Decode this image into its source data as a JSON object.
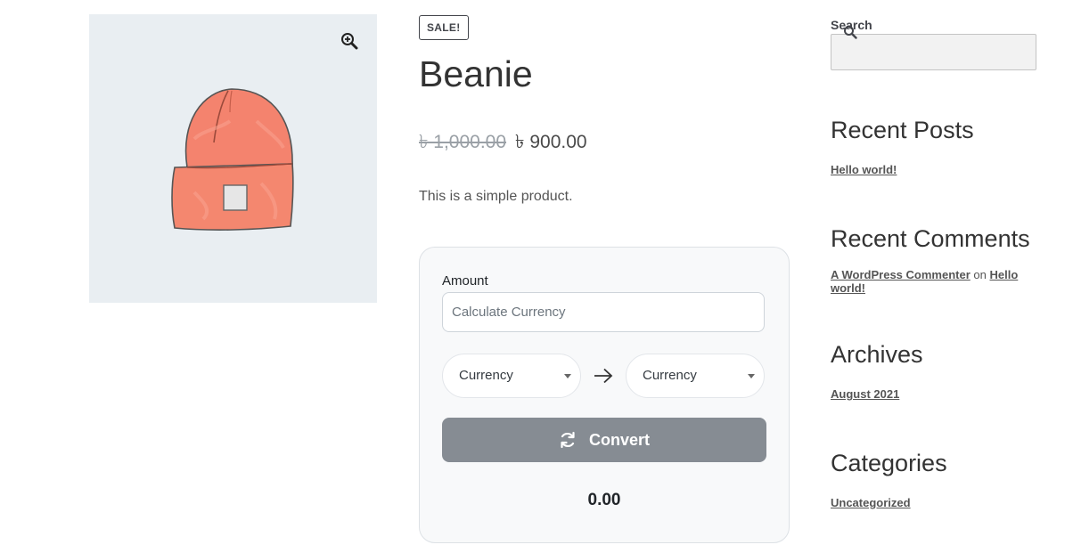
{
  "product": {
    "sale_badge": "SALE!",
    "title": "Beanie",
    "price_old": "৳ 1,000.00",
    "price_new": "৳ 900.00",
    "short_description": "This is a simple product.",
    "image_icon": "beanie-hat-image",
    "zoom_icon": "zoom-in-icon"
  },
  "converter": {
    "amount_label": "Amount",
    "amount_placeholder": "Calculate Currency",
    "amount_value": "",
    "from_currency": "Currency",
    "to_currency": "Currency",
    "convert_label": "Convert",
    "result": "0.00",
    "button_color": "#868c93"
  },
  "sidebar": {
    "search_label": "Search",
    "recent_posts_title": "Recent Posts",
    "recent_posts": [
      "Hello world!"
    ],
    "recent_comments_title": "Recent Comments",
    "comment_author": "A WordPress Commenter",
    "comment_on": "on",
    "comment_post": "Hello world!",
    "archives_title": "Archives",
    "archives": [
      "August 2021"
    ],
    "categories_title": "Categories",
    "categories": [
      "Uncategorized"
    ]
  },
  "colors": {
    "image_bg": "#e9eef2",
    "beanie": "#f4836e",
    "card_bg": "#f8f9fa"
  }
}
